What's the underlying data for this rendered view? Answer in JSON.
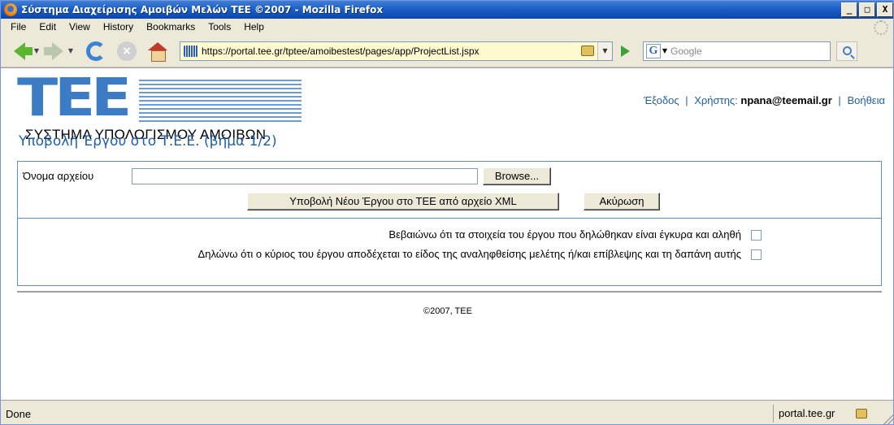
{
  "window": {
    "title": "Σύστημα Διαχείρισης Αμοιβών Μελών ΤΕΕ ©2007 - Mozilla Firefox",
    "minimize": "_",
    "maximize": "□",
    "close": "X"
  },
  "menu": [
    "File",
    "Edit",
    "View",
    "History",
    "Bookmarks",
    "Tools",
    "Help"
  ],
  "nav": {
    "url": "https://portal.tee.gr/tptee/amoibestest/pages/app/ProjectList.jspx",
    "search_placeholder": "Google",
    "search_engine_glyph": "G"
  },
  "header": {
    "logo_letters": [
      "T",
      "E",
      "E"
    ],
    "logo_subtitle": "ΣΥΣΤΗΜΑ ΥΠΟΛΟΓΙΣΜΟΥ ΑΜΟΙΒΩΝ",
    "logout": "Έξοδος",
    "user_label": "Χρήστης:",
    "user_email": "npana@teemail.gr",
    "help": "Βοήθεια",
    "separator": "|"
  },
  "page": {
    "title": "Υποβολή Έργου στο Τ.Ε.Ε. (βήμα 1/2)"
  },
  "form": {
    "file_label": "Όνομα αρχείου",
    "file_value": "",
    "browse_label": "Browse...",
    "submit_label": "Υποβολή Νέου Έργου στο ΤΕΕ από αρχείο XML",
    "cancel_label": "Ακύρωση",
    "declaration_1": "Βεβαιώνω ότι τα στοιχεία του έργου που δηλώθηκαν είναι έγκυρα και αληθή",
    "declaration_2": "Δηλώνω ότι ο κύριος του έργου αποδέχεται το είδος της αναληφθείσης μελέτης ή/και επίβλεψης και τη δαπάνη αυτής"
  },
  "footer": {
    "copyright": "©2007, TEE"
  },
  "status": {
    "text": "Done",
    "domain": "portal.tee.gr"
  },
  "colors": {
    "accent": "#1e5fa8",
    "logo": "#3b7cc4",
    "box_border": "#5a8fcf"
  }
}
